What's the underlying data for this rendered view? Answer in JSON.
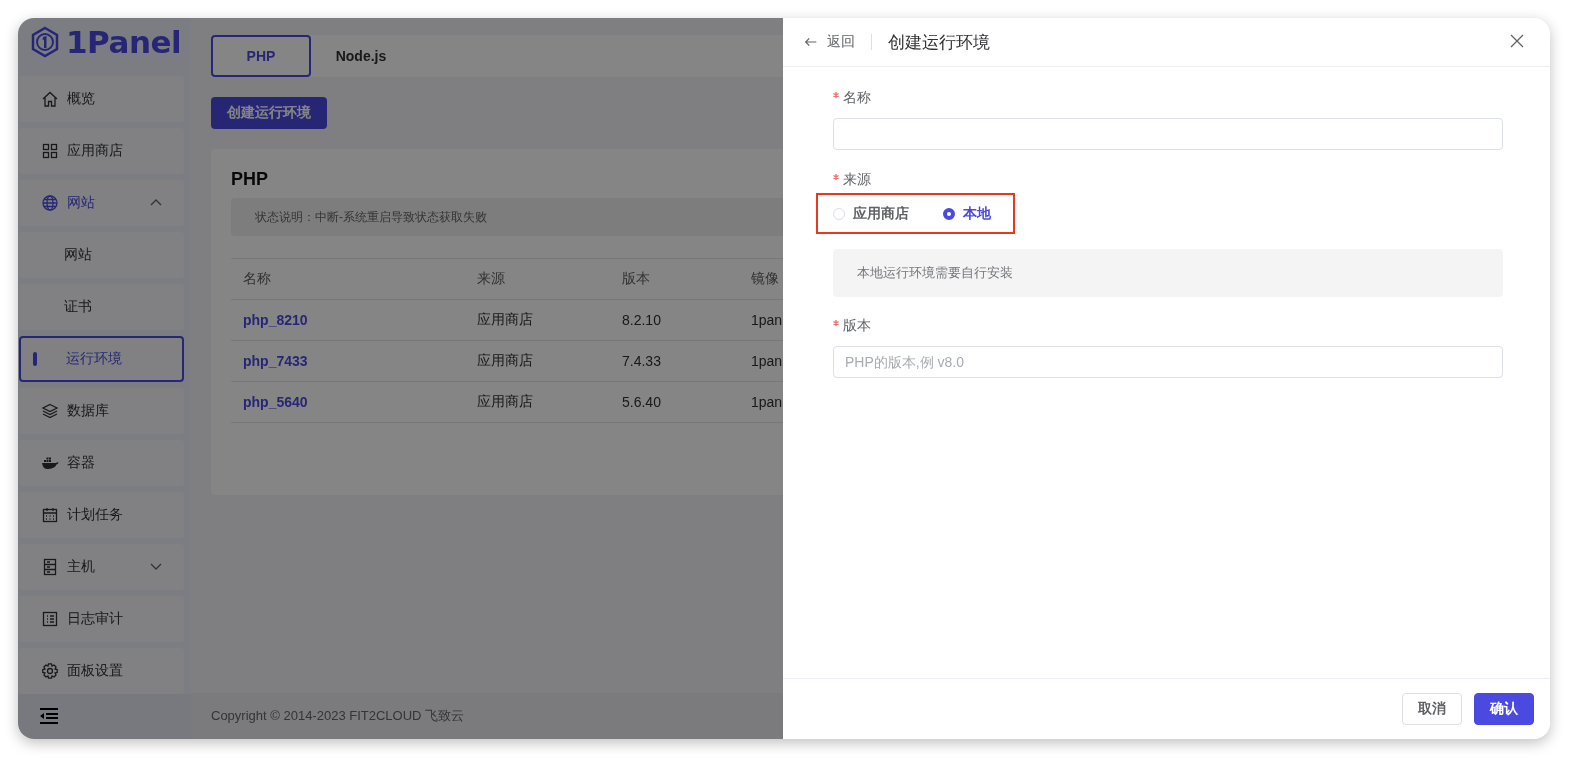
{
  "sidebar": {
    "logo": "1Panel",
    "items": [
      {
        "label": "概览",
        "selected": false
      },
      {
        "label": "应用商店",
        "selected": false
      },
      {
        "label": "网站",
        "selected": false,
        "expanded": true,
        "children": [
          {
            "label": "网站",
            "selected": false
          },
          {
            "label": "证书",
            "selected": false
          },
          {
            "label": "运行环境",
            "selected": true
          }
        ]
      },
      {
        "label": "数据库",
        "selected": false
      },
      {
        "label": "容器",
        "selected": false
      },
      {
        "label": "计划任务",
        "selected": false
      },
      {
        "label": "主机",
        "selected": false,
        "expanded": false
      },
      {
        "label": "日志审计",
        "selected": false
      },
      {
        "label": "面板设置",
        "selected": false
      }
    ]
  },
  "tabs": [
    {
      "label": "PHP",
      "selected": true
    },
    {
      "label": "Node.js",
      "selected": false
    }
  ],
  "create_button": "创建运行环境",
  "card": {
    "title": "PHP",
    "notice": "状态说明：中断-系统重启导致状态获取失败",
    "table": {
      "columns": [
        "名称",
        "来源",
        "版本",
        "镜像"
      ],
      "rows": [
        [
          "php_8210",
          "应用商店",
          "8.2.10",
          "1pan"
        ],
        [
          "php_7433",
          "应用商店",
          "7.4.33",
          "1pan"
        ],
        [
          "php_5640",
          "应用商店",
          "5.6.40",
          "1pan"
        ]
      ]
    }
  },
  "footer": "Copyright © 2014-2023 FIT2CLOUD 飞致云",
  "drawer": {
    "back": "返回",
    "title": "创建运行环境",
    "fields": [
      {
        "kind": "input",
        "label": "名称",
        "required": true
      },
      {
        "kind": "radio",
        "label": "来源",
        "required": true,
        "options": [
          {
            "label": "应用商店",
            "selected": false
          },
          {
            "label": "本地",
            "selected": true
          }
        ]
      },
      {
        "kind": "notice",
        "text": "本地运行环境需要自行安装"
      },
      {
        "kind": "input",
        "label": "版本",
        "required": true,
        "placeholder": "PHP的版本,例 v8.0"
      }
    ],
    "buttons": [
      {
        "label": "取消",
        "kind": "secondary"
      },
      {
        "label": "确认",
        "kind": "primary"
      }
    ]
  }
}
